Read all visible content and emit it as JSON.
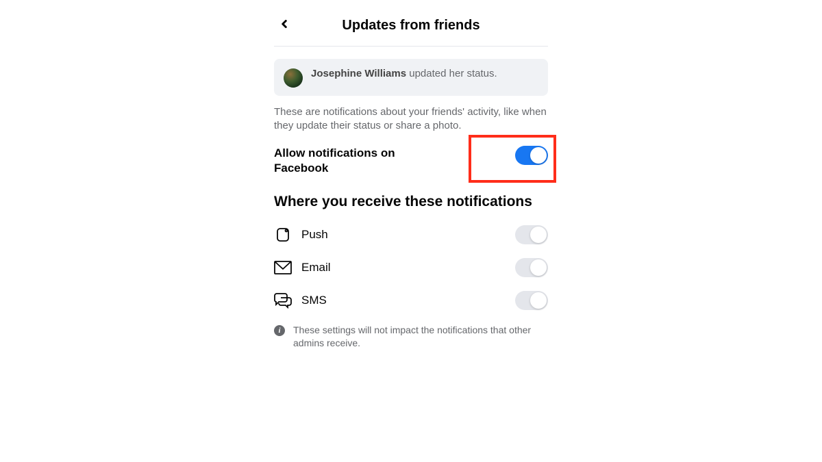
{
  "header": {
    "title": "Updates from friends"
  },
  "preview": {
    "name": "Josephine Williams",
    "action": " updated her status."
  },
  "description": "These are notifications about your friends' activity, like when they update their status or share a photo.",
  "allow": {
    "label": "Allow notifications on Facebook",
    "enabled": true
  },
  "channels_heading": "Where you receive these notifications",
  "channels": [
    {
      "label": "Push",
      "enabled": false
    },
    {
      "label": "Email",
      "enabled": false
    },
    {
      "label": "SMS",
      "enabled": false
    }
  ],
  "info": "These settings will not impact the notifications that other admins receive."
}
